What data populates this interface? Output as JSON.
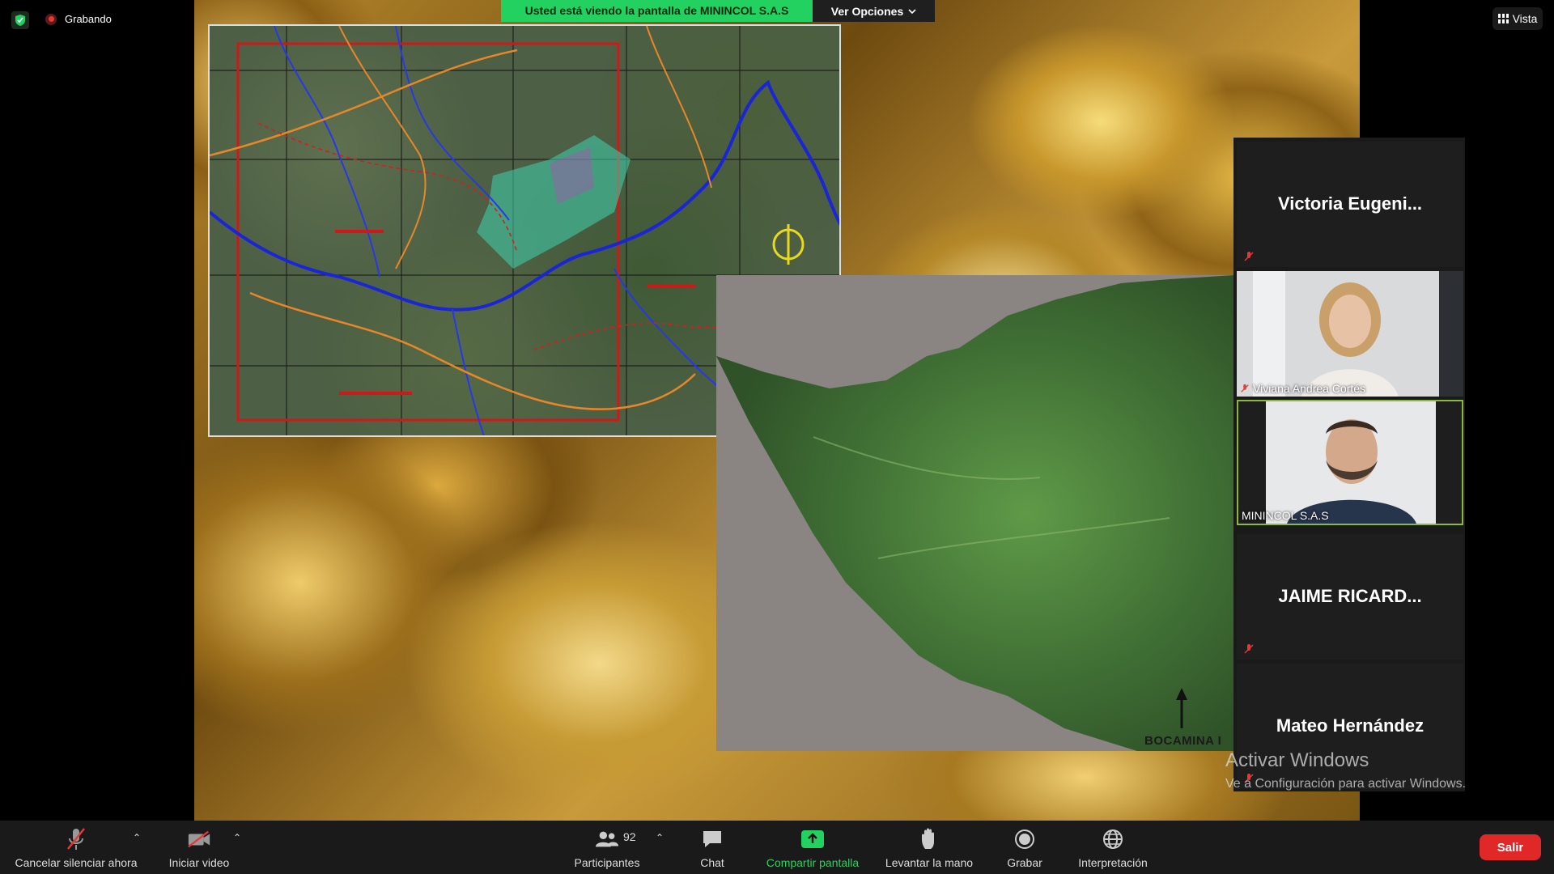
{
  "top": {
    "recording_label": "Grabando",
    "share_banner": "Usted está viendo la pantalla de MININCOL S.A.S",
    "view_options": "Ver Opciones",
    "view_button": "Vista"
  },
  "slide": {
    "terrain_label": "BOCAMINA I"
  },
  "participants_panel": [
    {
      "name": "Victoria  Eugeni...",
      "type": "name",
      "muted": true
    },
    {
      "name": "Viviana Andrea Cortés",
      "type": "video",
      "muted": true
    },
    {
      "name": "MININCOL S.A.S",
      "type": "video",
      "muted": false,
      "active": true
    },
    {
      "name": "JAIME  RICARD...",
      "type": "name",
      "muted": true
    },
    {
      "name": "Mateo Hernández",
      "type": "name",
      "muted": true
    }
  ],
  "watermark": {
    "title": "Activar Windows",
    "subtitle": "Ve a Configuración para activar Windows."
  },
  "toolbar": {
    "unmute": "Cancelar silenciar ahora",
    "start_video": "Iniciar video",
    "participants": "Participantes",
    "participants_count": "92",
    "chat": "Chat",
    "share": "Compartir pantalla",
    "raise_hand": "Levantar la mano",
    "record": "Grabar",
    "interpretation": "Interpretación",
    "leave": "Salir"
  },
  "colors": {
    "share_green": "#23d160",
    "leave_red": "#e02828",
    "active_border": "#8ab940"
  }
}
